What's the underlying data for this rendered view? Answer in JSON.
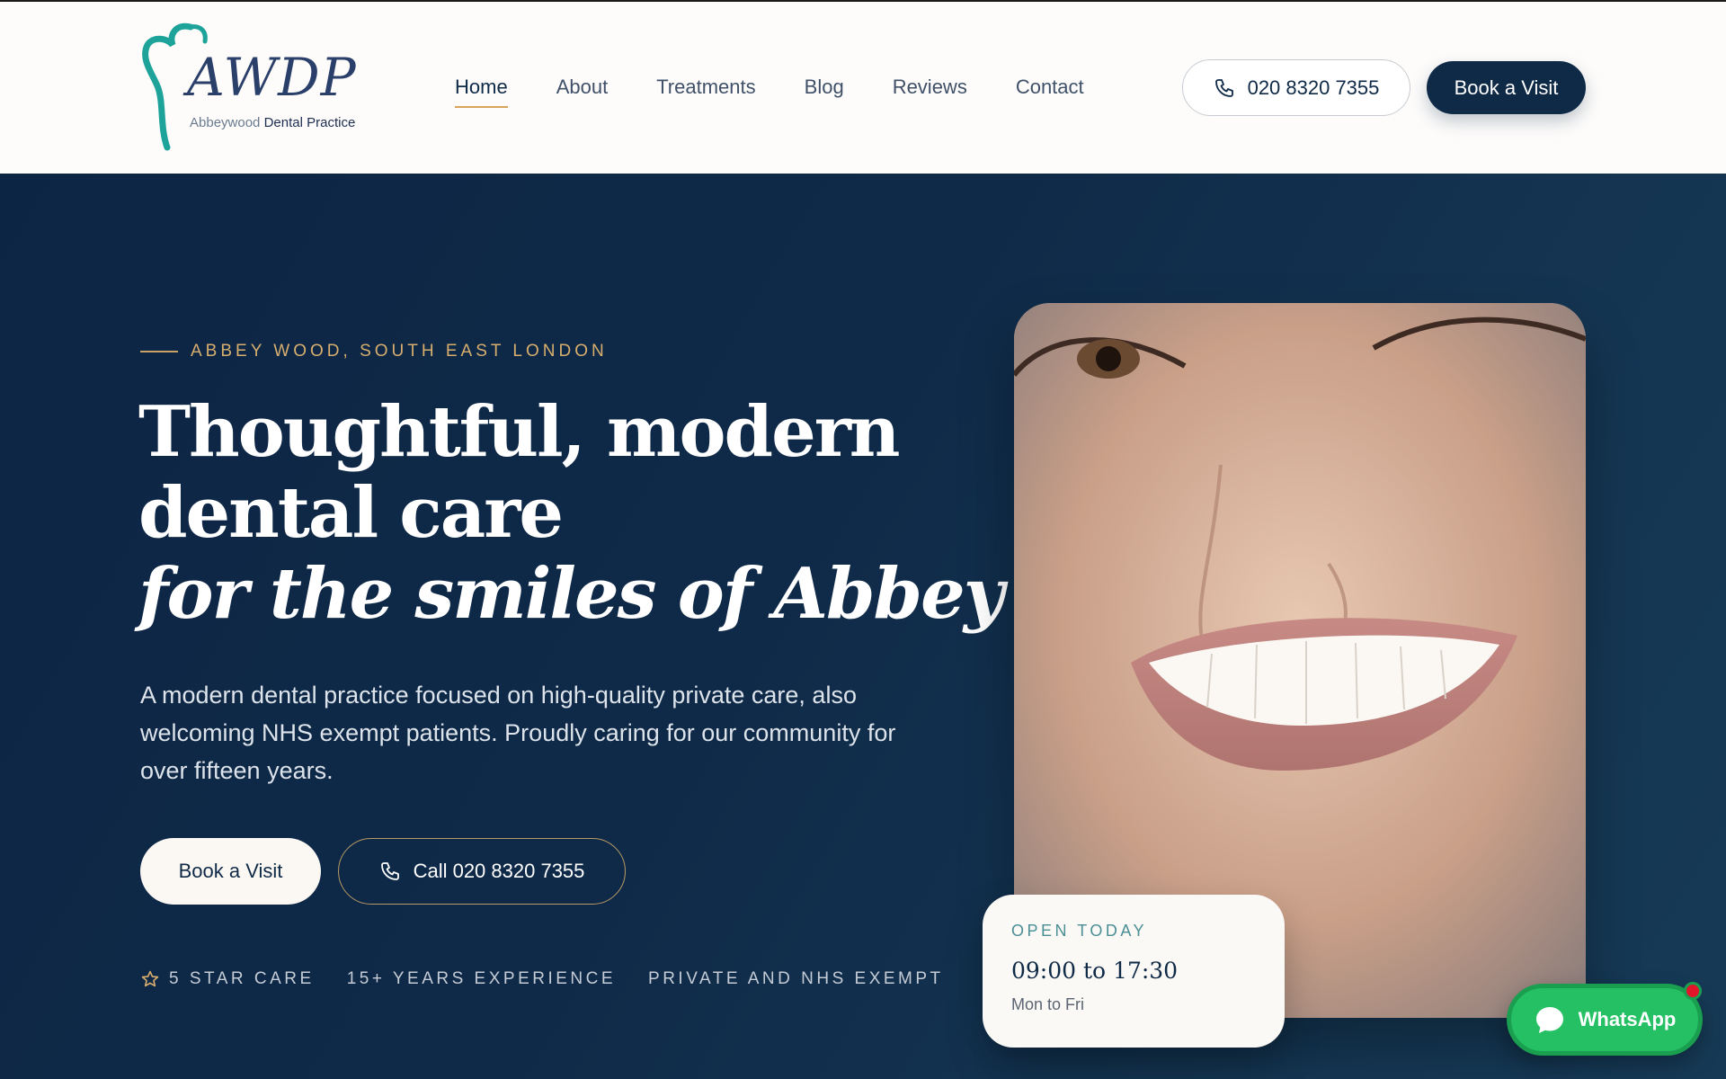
{
  "brand": {
    "logo_mark": "AWDP",
    "logo_sub_light": "Abbeywood",
    "logo_sub_bold": " Dental Practice"
  },
  "nav": {
    "items": [
      {
        "label": "Home",
        "active": true
      },
      {
        "label": "About"
      },
      {
        "label": "Treatments"
      },
      {
        "label": "Blog"
      },
      {
        "label": "Reviews"
      },
      {
        "label": "Contact"
      }
    ]
  },
  "header": {
    "phone": "020 8320 7355",
    "book_label": "Book a Visit"
  },
  "hero": {
    "eyebrow": "ABBEY WOOD, SOUTH EAST LONDON",
    "headline_1": "Thoughtful, modern",
    "headline_2": "dental care",
    "headline_3": "for the smiles of Abbey Wood.",
    "lead": "A modern dental practice focused on high-quality private care, also welcoming NHS exempt patients. Proudly caring for our community for over fifteen years.",
    "book_label": "Book a Visit",
    "call_label": "Call 020 8320 7355",
    "badges": [
      "5 STAR CARE",
      "15+ YEARS EXPERIENCE",
      "PRIVATE AND NHS EXEMPT"
    ]
  },
  "hours": {
    "label": "OPEN TODAY",
    "time": "09:00 to 17:30",
    "days": "Mon to Fri"
  },
  "whatsapp": {
    "label": "WhatsApp"
  },
  "colors": {
    "navy": "#0f2a47",
    "gold": "#d7ae6d",
    "teal": "#4a8f96",
    "whatsapp_green": "#25c063"
  }
}
